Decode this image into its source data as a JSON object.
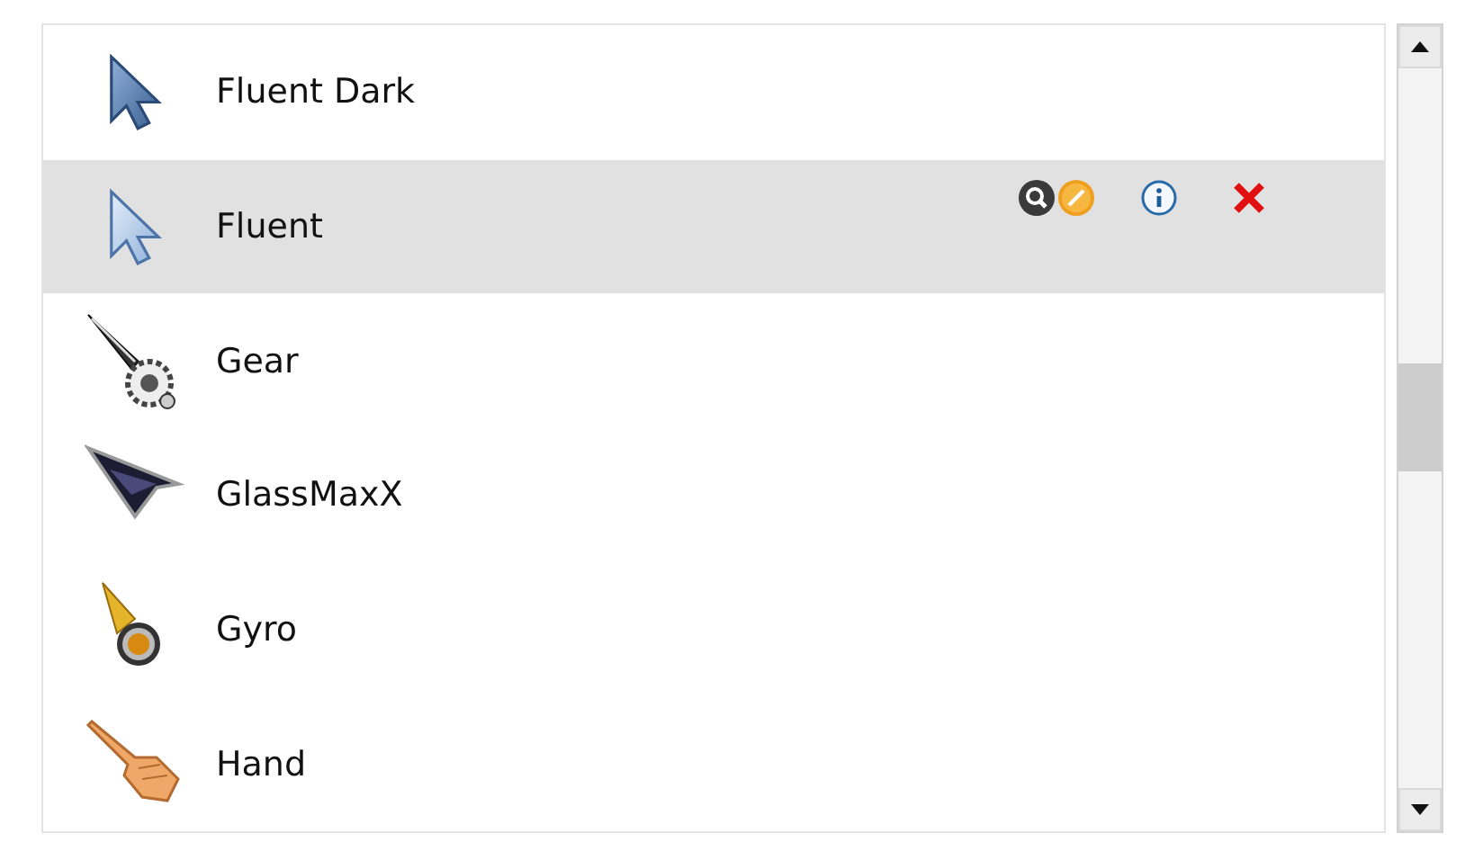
{
  "cursor_schemes": [
    {
      "label": "Fluent Dark",
      "selected": false
    },
    {
      "label": "Fluent",
      "selected": true
    },
    {
      "label": "Gear",
      "selected": false
    },
    {
      "label": "GlassMaxX",
      "selected": false
    },
    {
      "label": "Gyro",
      "selected": false
    },
    {
      "label": "Hand",
      "selected": false
    }
  ]
}
